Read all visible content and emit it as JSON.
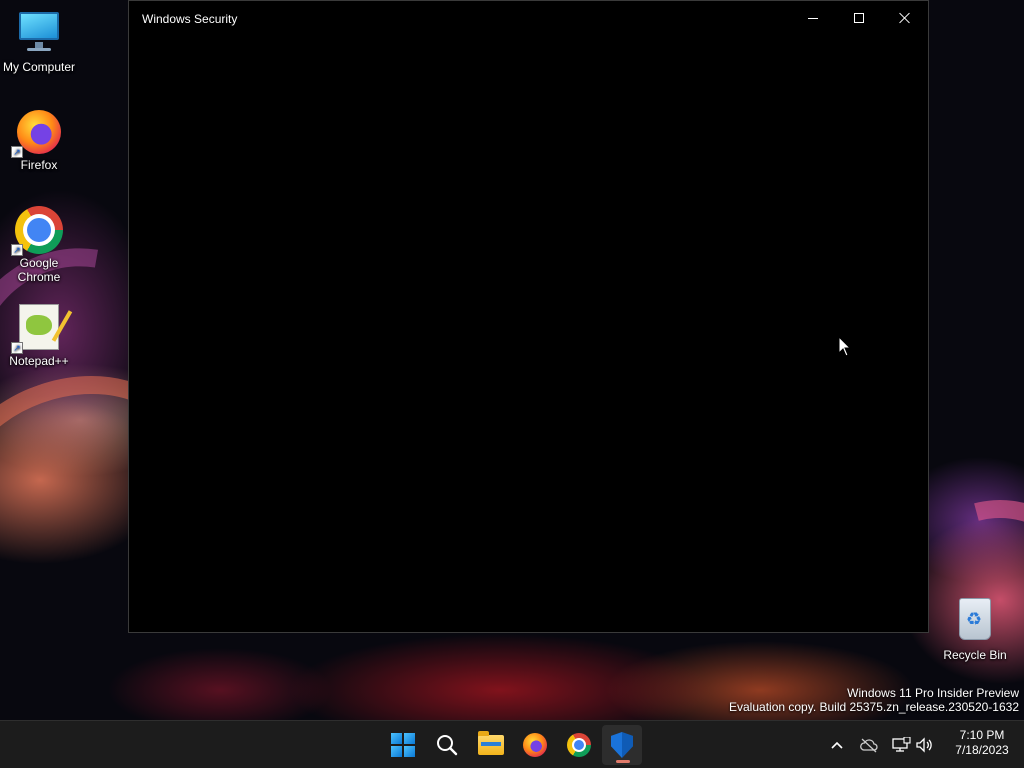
{
  "desktop": {
    "icons": [
      {
        "label": "My Computer",
        "icon": "monitor-icon"
      },
      {
        "label": "Firefox",
        "icon": "firefox-icon"
      },
      {
        "label": "Google Chrome",
        "icon": "chrome-icon"
      },
      {
        "label": "Notepad++",
        "icon": "notepad-plus-plus-icon"
      },
      {
        "label": "Recycle Bin",
        "icon": "recycle-bin-icon"
      }
    ]
  },
  "window": {
    "title": "Windows Security",
    "controls": {
      "minimize": "minimize-icon",
      "maximize": "maximize-icon",
      "close": "close-icon"
    },
    "content_color": "#000000"
  },
  "watermark": {
    "line1": "Windows 11 Pro Insider Preview",
    "line2": "Evaluation copy. Build 25375.zn_release.230520-1632"
  },
  "taskbar": {
    "apps": [
      {
        "name": "Start",
        "icon": "windows-start-icon"
      },
      {
        "name": "Search",
        "icon": "search-icon"
      },
      {
        "name": "File Explorer",
        "icon": "folder-icon"
      },
      {
        "name": "Firefox",
        "icon": "firefox-icon"
      },
      {
        "name": "Google Chrome",
        "icon": "chrome-icon"
      },
      {
        "name": "Windows Security",
        "icon": "shield-icon",
        "active": true
      }
    ],
    "tray": {
      "icons": [
        "chevron-up-icon",
        "cloud-offline-icon",
        "network-icon",
        "volume-icon"
      ],
      "time": "7:10 PM",
      "date": "7/18/2023"
    },
    "accent_color": "#e07a6a"
  }
}
